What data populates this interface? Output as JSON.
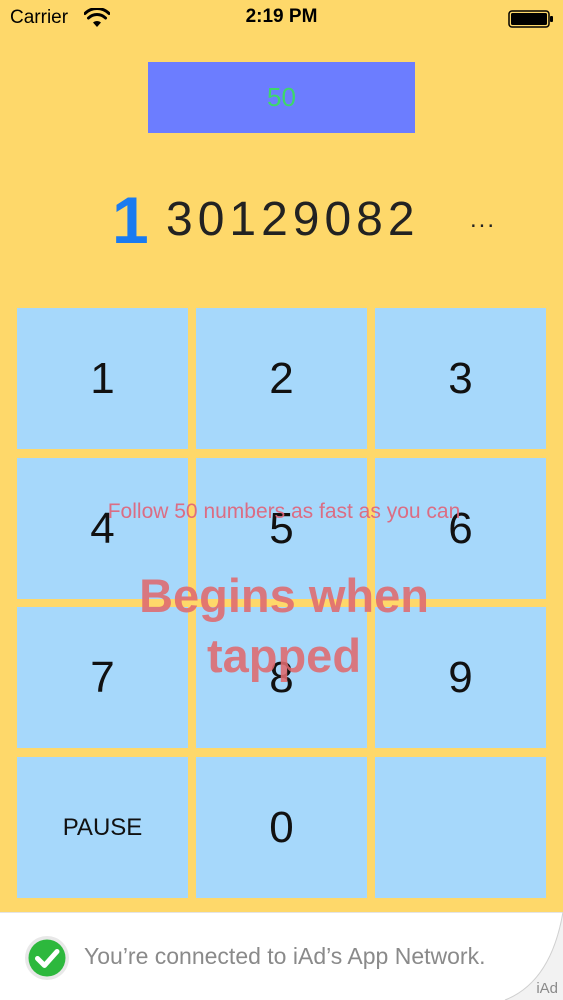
{
  "status_bar": {
    "carrier": "Carrier",
    "time": "2:19 PM"
  },
  "game": {
    "remaining": "50",
    "current_number": "1",
    "upcoming_numbers": "30129082",
    "ellipsis": "..."
  },
  "keypad": {
    "keys": [
      {
        "label": "1"
      },
      {
        "label": "2"
      },
      {
        "label": "3"
      },
      {
        "label": "4"
      },
      {
        "label": "5"
      },
      {
        "label": "6"
      },
      {
        "label": "7"
      },
      {
        "label": "8"
      },
      {
        "label": "9"
      },
      {
        "label": "PAUSE"
      },
      {
        "label": "0"
      },
      {
        "label": ""
      }
    ]
  },
  "overlay": {
    "instruction": "Follow 50 numbers as fast as you can",
    "prompt": "Begins when tapped"
  },
  "ad": {
    "message": "You’re connected to iAd’s App Network.",
    "label": "iAd"
  },
  "colors": {
    "background": "#FED86A",
    "target_box": "#6C7DFF",
    "target_text": "#3DD869",
    "current_number": "#1A7BF0",
    "key_fill": "#A6D8FB",
    "overlay_text": "#E0647A"
  }
}
